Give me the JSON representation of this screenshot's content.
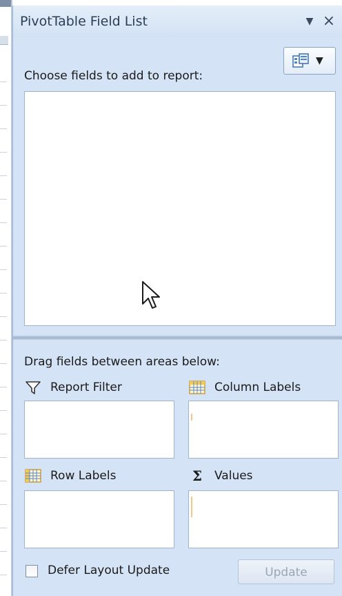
{
  "pane": {
    "title": "PivotTable Field List",
    "dropdown_glyph": "▼",
    "close_glyph": "×"
  },
  "layout_button": {
    "caret": "▼",
    "icon": "field-list-layout-icon"
  },
  "field_section": {
    "label": "Choose fields to add to report:"
  },
  "areas": {
    "instruction": "Drag fields between areas below:",
    "report_filter": {
      "label": "Report Filter",
      "icon": "filter-icon"
    },
    "column_labels": {
      "label": "Column Labels",
      "icon": "column-grid-icon"
    },
    "row_labels": {
      "label": "Row Labels",
      "icon": "row-grid-icon"
    },
    "values": {
      "label": "Values",
      "icon": "sigma-icon",
      "glyph": "Σ"
    }
  },
  "footer": {
    "defer_label": "Defer Layout Update",
    "defer_checked": false,
    "update_label": "Update"
  },
  "colors": {
    "pane_bg": "#d4e3f5",
    "border": "#9fb3cd",
    "disabled_text": "#9aa6b5"
  }
}
